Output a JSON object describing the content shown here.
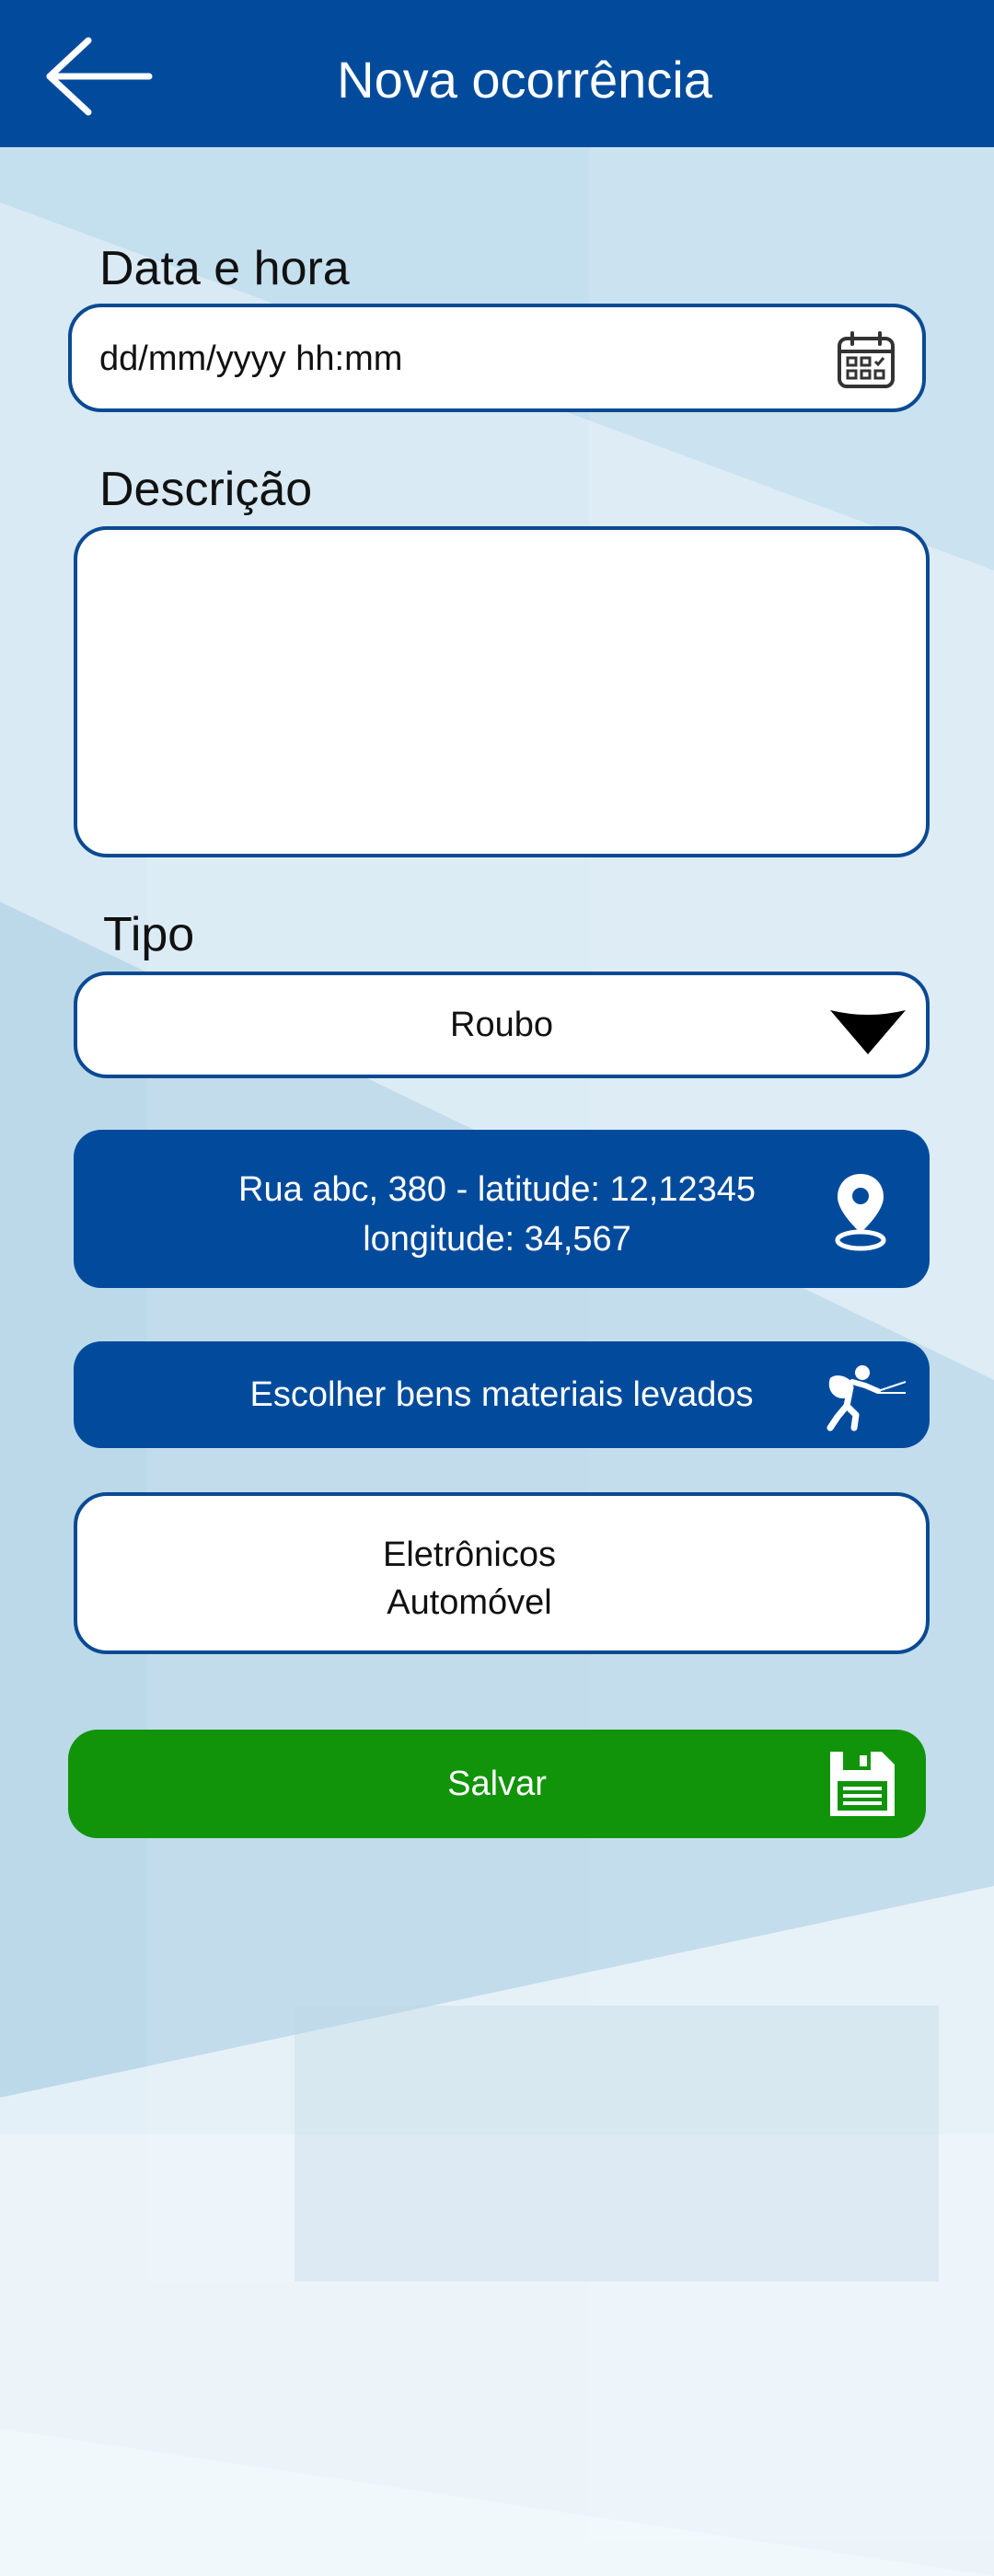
{
  "header": {
    "title": "Nova ocorrência",
    "back_icon": "arrow-left-icon"
  },
  "form": {
    "datetime": {
      "label": "Data e hora",
      "placeholder": "dd/mm/yyyy hh:mm",
      "value": "",
      "icon": "calendar-icon"
    },
    "description": {
      "label": "Descrição",
      "value": ""
    },
    "type": {
      "label": "Tipo",
      "selected": "Roubo",
      "icon": "chevron-down-icon"
    },
    "location": {
      "line1": "Rua abc, 380 - latitude: 12,12345",
      "line2": "longitude: 34,567",
      "icon": "map-pin-icon"
    },
    "goods_button": {
      "label": "Escolher bens materiais levados",
      "icon": "thief-icon"
    },
    "selected_goods": [
      "Eletrônicos",
      "Automóvel"
    ],
    "save_button": {
      "label": "Salvar",
      "icon": "floppy-disk-icon"
    }
  },
  "colors": {
    "primary": "#024b9c",
    "save": "#11940a",
    "background": "#d4e7f2"
  }
}
